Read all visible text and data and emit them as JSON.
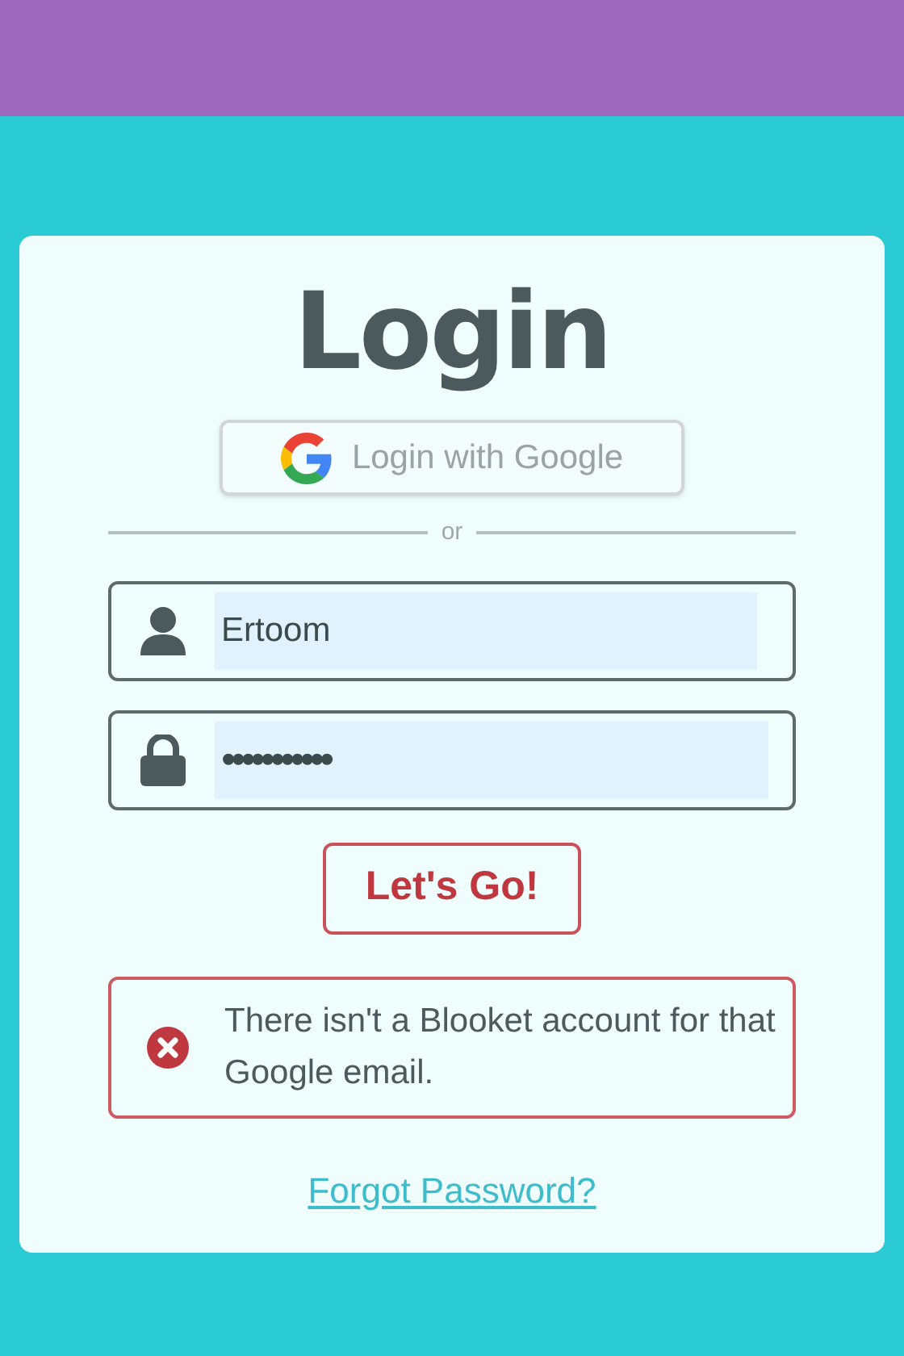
{
  "title": "Login",
  "google_button": {
    "label": "Login with Google"
  },
  "divider": {
    "label": "or"
  },
  "fields": [
    {
      "kind": "username",
      "value": "Ertoom"
    },
    {
      "kind": "password",
      "value": "•••••••••••"
    }
  ],
  "submit_button": {
    "label": "Let's Go!"
  },
  "error": {
    "message": "There isn't a Blooket account for that Google email."
  },
  "forgot_link": {
    "label": "Forgot Password?"
  }
}
